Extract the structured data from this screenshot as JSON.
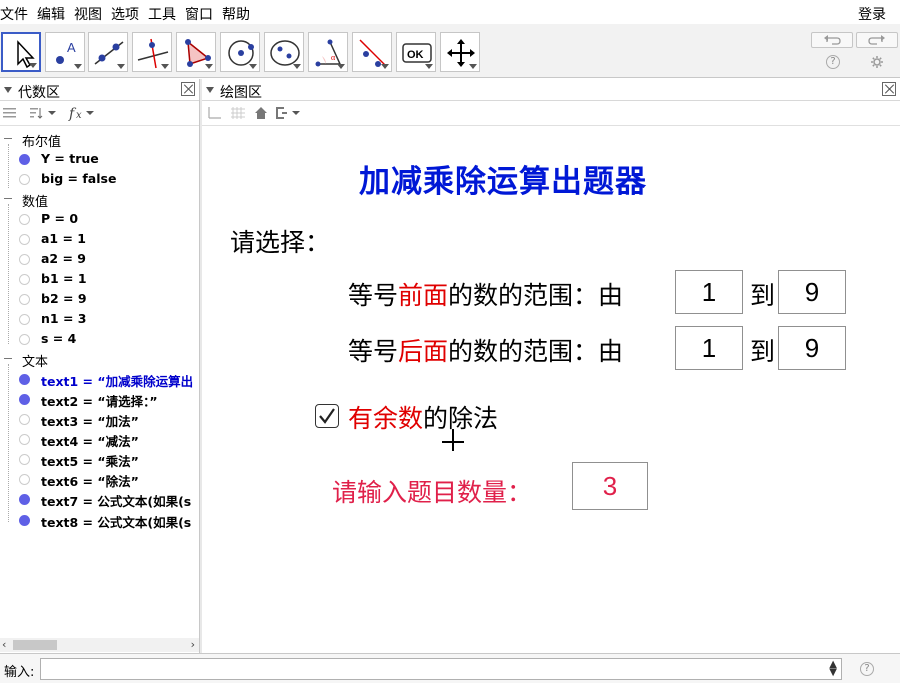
{
  "menu": {
    "items": [
      "文件",
      "编辑",
      "视图",
      "选项",
      "工具",
      "窗口",
      "帮助"
    ],
    "login": "登录"
  },
  "toolbar": {
    "tools": [
      "move-tool",
      "point-tool",
      "line-tool",
      "perpendicular-tool",
      "polygon-tool",
      "circle-tool",
      "ellipse-tool",
      "angle-tool",
      "reflect-tool",
      "button-tool",
      "move-view-tool"
    ],
    "ok_label": "OK"
  },
  "algebra": {
    "title": "代数区",
    "groups": {
      "boolean": "布尔值",
      "number": "数值",
      "text": "文本"
    },
    "boolean_items": [
      "Y = true",
      "big = false"
    ],
    "number_items": [
      "P = 0",
      "a1 = 1",
      "a2 = 9",
      "b1 = 1",
      "b2 = 9",
      "n1 = 3",
      "s = 4"
    ],
    "text_items": [
      "text1 = “加减乘除运算出",
      "text2 = “请选择：”",
      "text3 = “加法”",
      "text4 = “减法”",
      "text5 = “乘法”",
      "text6 = “除法”",
      "text7 = 公式文本(如果(s",
      "text8 = 公式文本(如果(s"
    ]
  },
  "graphics": {
    "title": "绘图区",
    "heading": "加减乘除运算出题器",
    "prompt": "请选择：",
    "range_front": {
      "prefix": "等号",
      "highlight": "前面",
      "suffix": "的数的范围：由",
      "to": "到",
      "from_value": "1",
      "to_value": "9"
    },
    "range_back": {
      "prefix": "等号",
      "highlight": "后面",
      "suffix": "的数的范围：由",
      "to": "到",
      "from_value": "1",
      "to_value": "9"
    },
    "remainder": {
      "highlight": "有余数",
      "suffix": "的除法",
      "checked": true
    },
    "count": {
      "label": "请输入题目数量：",
      "value": "3"
    }
  },
  "input": {
    "label": "输入:"
  },
  "colors": {
    "title_blue": "#0018d6",
    "highlight_red": "#e00000",
    "count_red": "#e0204a",
    "dot_blue": "#5f60e6",
    "selected_text_blue": "#0000cc"
  }
}
